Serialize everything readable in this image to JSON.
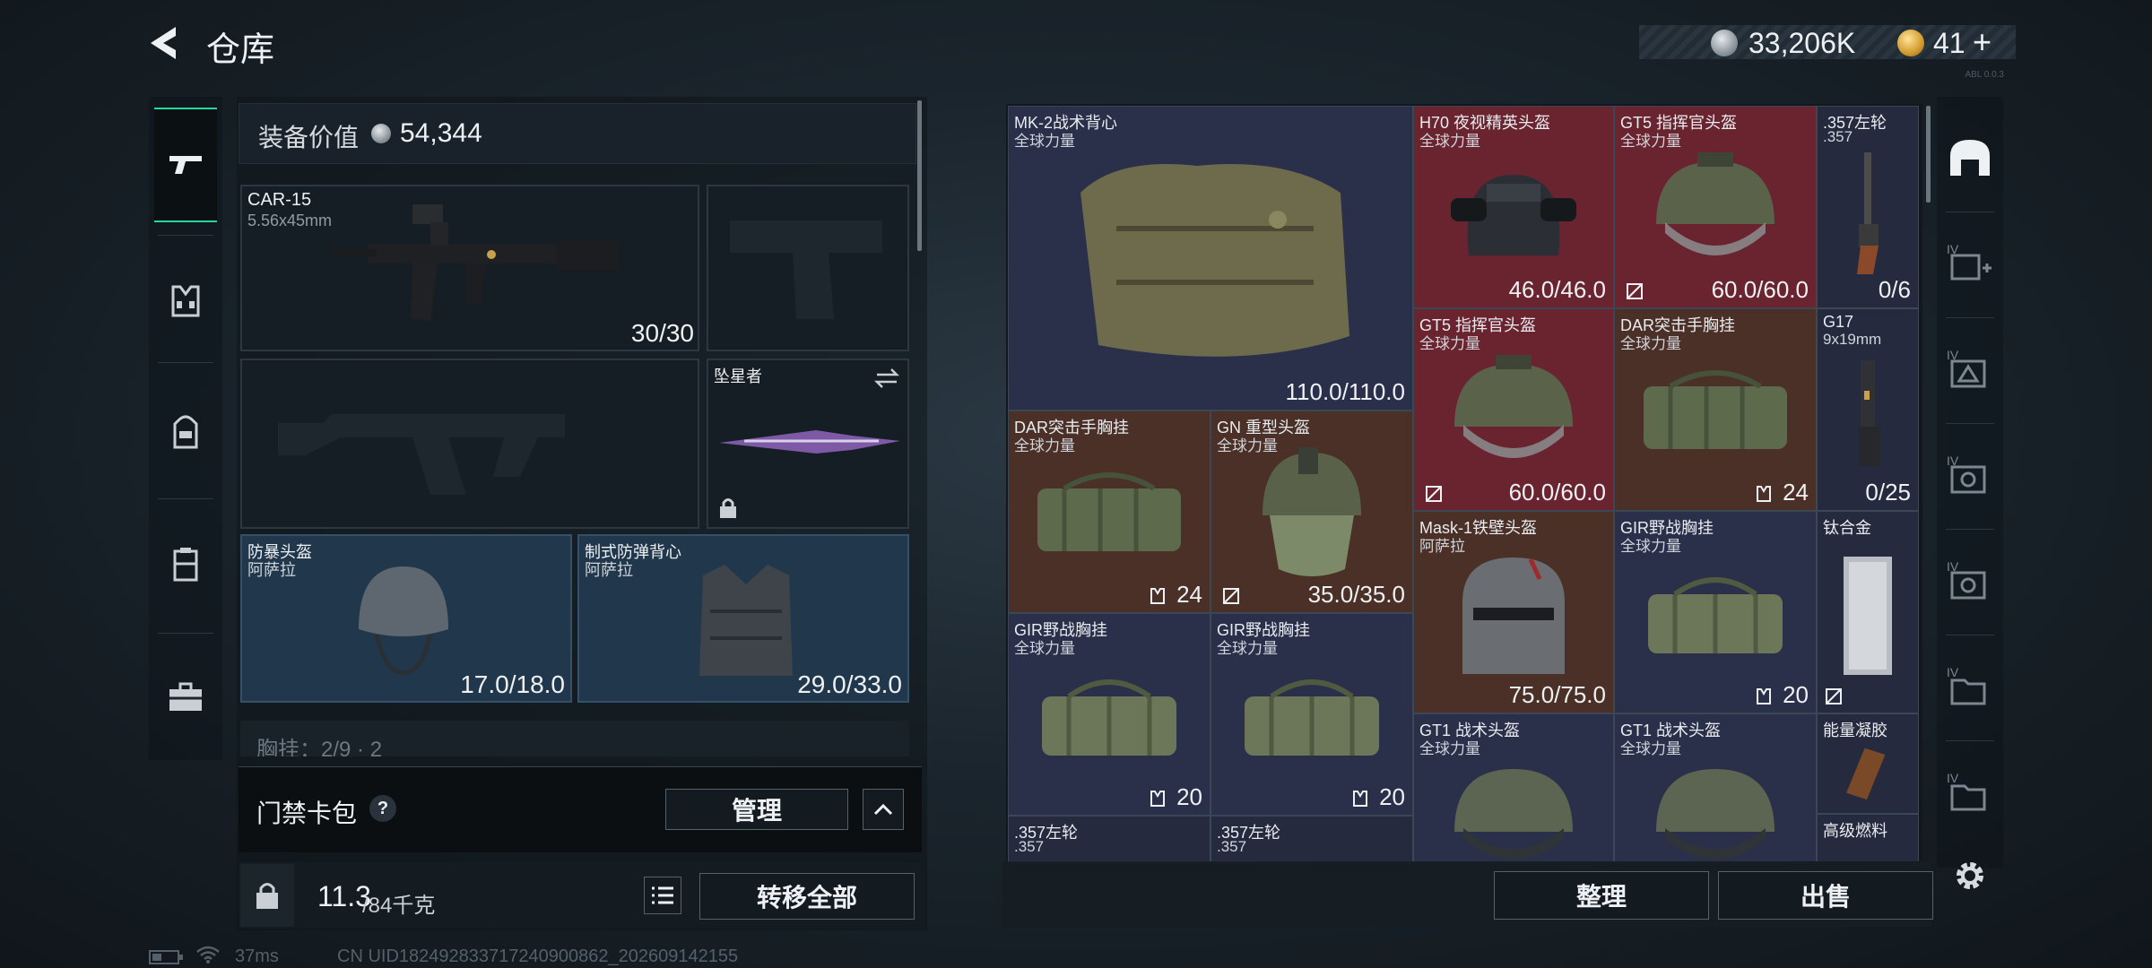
{
  "header": {
    "title": "仓库",
    "currency_silver": "33,206K",
    "currency_gold": "41",
    "gold_add": "+",
    "tiny_note": "ABL 0.0.3",
    "icons": [
      "back-arrow-icon",
      "silver-coin-icon",
      "gold-coin-icon"
    ]
  },
  "left_nav": {
    "items": [
      "rifle-icon",
      "vest-icon",
      "backpack-icon",
      "chest-rig-icon",
      "briefcase-icon"
    ],
    "active": 0,
    "accent": "#27d7a0"
  },
  "equipment": {
    "value_label": "装备价值",
    "value": "54,344",
    "primary_weapon": {
      "name": "CAR-15",
      "caliber": "5.56x45mm",
      "ammo": "30/30"
    },
    "melee": {
      "name": "坠星者"
    },
    "helmet": {
      "name": "防暴头盔",
      "sub": "阿萨拉",
      "durability": "17.0/18.0"
    },
    "armor": {
      "name": "制式防弹背心",
      "sub": "阿萨拉",
      "durability": "29.0/33.0"
    },
    "chest_rig_peek": "胸挂：2/9 · 2",
    "card_pack": {
      "label": "门禁卡包",
      "help": "?",
      "manage": "管理"
    },
    "weight": {
      "current": "11.3",
      "max": "/84千克"
    },
    "transfer_all": "转移全部"
  },
  "stash": {
    "items": [
      {
        "id": "mk2",
        "name": "MK-2战术背心",
        "sub": "全球力量",
        "value": "110.0/110.0",
        "tone": "def"
      },
      {
        "id": "h70",
        "name": "H70 夜视精英头盔",
        "sub": "全球力量",
        "value": "46.0/46.0",
        "tone": "red"
      },
      {
        "id": "gt5a",
        "name": "GT5 指挥官头盔",
        "sub": "全球力量",
        "value": "60.0/60.0",
        "tone": "red"
      },
      {
        "id": "rev1",
        "name": ".357左轮",
        "sub": ".357",
        "value": "0/6",
        "tone": "dk"
      },
      {
        "id": "gt5b",
        "name": "GT5 指挥官头盔",
        "sub": "全球力量",
        "value": "60.0/60.0",
        "tone": "red"
      },
      {
        "id": "dar1",
        "name": "DAR突击手胸挂",
        "sub": "全球力量",
        "value": "24",
        "tone": "brn"
      },
      {
        "id": "g17",
        "name": "G17",
        "sub": "9x19mm",
        "value": "0/25",
        "tone": "dk"
      },
      {
        "id": "dar2",
        "name": "DAR突击手胸挂",
        "sub": "全球力量",
        "value": "24",
        "tone": "brn"
      },
      {
        "id": "gn",
        "name": "GN 重型头盔",
        "sub": "全球力量",
        "value": "35.0/35.0",
        "tone": "brn"
      },
      {
        "id": "mask1",
        "name": "Mask-1铁壁头盔",
        "sub": "阿萨拉",
        "value": "75.0/75.0",
        "tone": "brn"
      },
      {
        "id": "gir1",
        "name": "GIR野战胸挂",
        "sub": "全球力量",
        "value": "20",
        "tone": "def"
      },
      {
        "id": "titanium",
        "name": "钛合金",
        "sub": "",
        "value": "",
        "tone": "dk"
      },
      {
        "id": "gir2",
        "name": "GIR野战胸挂",
        "sub": "全球力量",
        "value": "20",
        "tone": "def"
      },
      {
        "id": "gir3",
        "name": "GIR野战胸挂",
        "sub": "全球力量",
        "value": "20",
        "tone": "def"
      },
      {
        "id": "gt1a",
        "name": "GT1 战术头盔",
        "sub": "全球力量",
        "value": "",
        "tone": "def"
      },
      {
        "id": "gt1b",
        "name": "GT1 战术头盔",
        "sub": "全球力量",
        "value": "",
        "tone": "def"
      },
      {
        "id": "energy",
        "name": "能量凝胶",
        "sub": "",
        "value": "",
        "tone": "dk"
      },
      {
        "id": "rev2",
        "name": ".357左轮",
        "sub": ".357",
        "value": "",
        "tone": "dk"
      },
      {
        "id": "rev3",
        "name": ".357左轮",
        "sub": ".357",
        "value": "",
        "tone": "dk"
      },
      {
        "id": "fuel",
        "name": "高级燃料",
        "sub": "",
        "value": "",
        "tone": "dk"
      }
    ],
    "sort_button": "整理",
    "sell_button": "出售"
  },
  "right_nav": {
    "items": [
      "stash-arch-icon",
      "medkit-expand-icon",
      "triangle-box-icon",
      "gear-box-icon",
      "gear-box-2-icon",
      "folder-box-icon",
      "folder-box-2-icon"
    ],
    "tier_label": "IV",
    "settings": "settings-gear-icon"
  },
  "status": {
    "ping": "37ms",
    "uid": "CN UID1824928337172409008​62_202609142155"
  }
}
